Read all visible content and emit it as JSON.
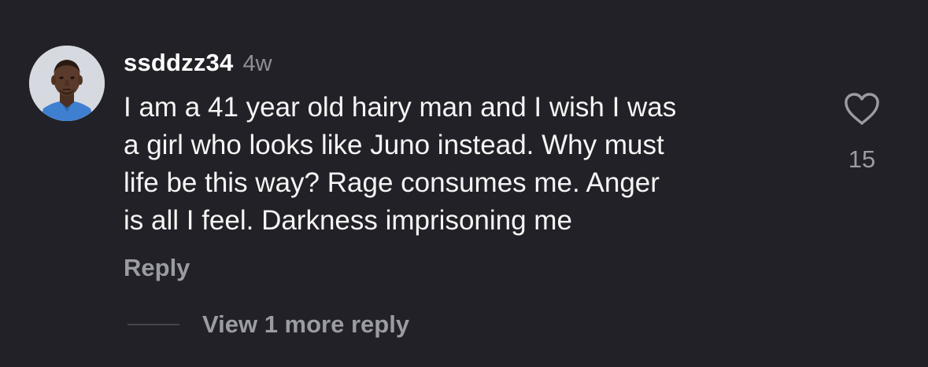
{
  "comment": {
    "username": "ssddzz34",
    "age": "4w",
    "text_lines": [
      "I am a 41 year old hairy man and I wish I was",
      "a girl who looks like Juno instead. Why must",
      "life be this way? Rage consumes me. Anger",
      "is all I feel. Darkness imprisoning me"
    ],
    "like_count": "15",
    "like_icon": "heart-outline-icon",
    "reply_label": "Reply",
    "view_more_label": "View 1 more reply"
  },
  "colors": {
    "background": "#212127",
    "primary_text": "#ffffff",
    "secondary_text": "#9b9ba3",
    "divider": "#45454c"
  }
}
